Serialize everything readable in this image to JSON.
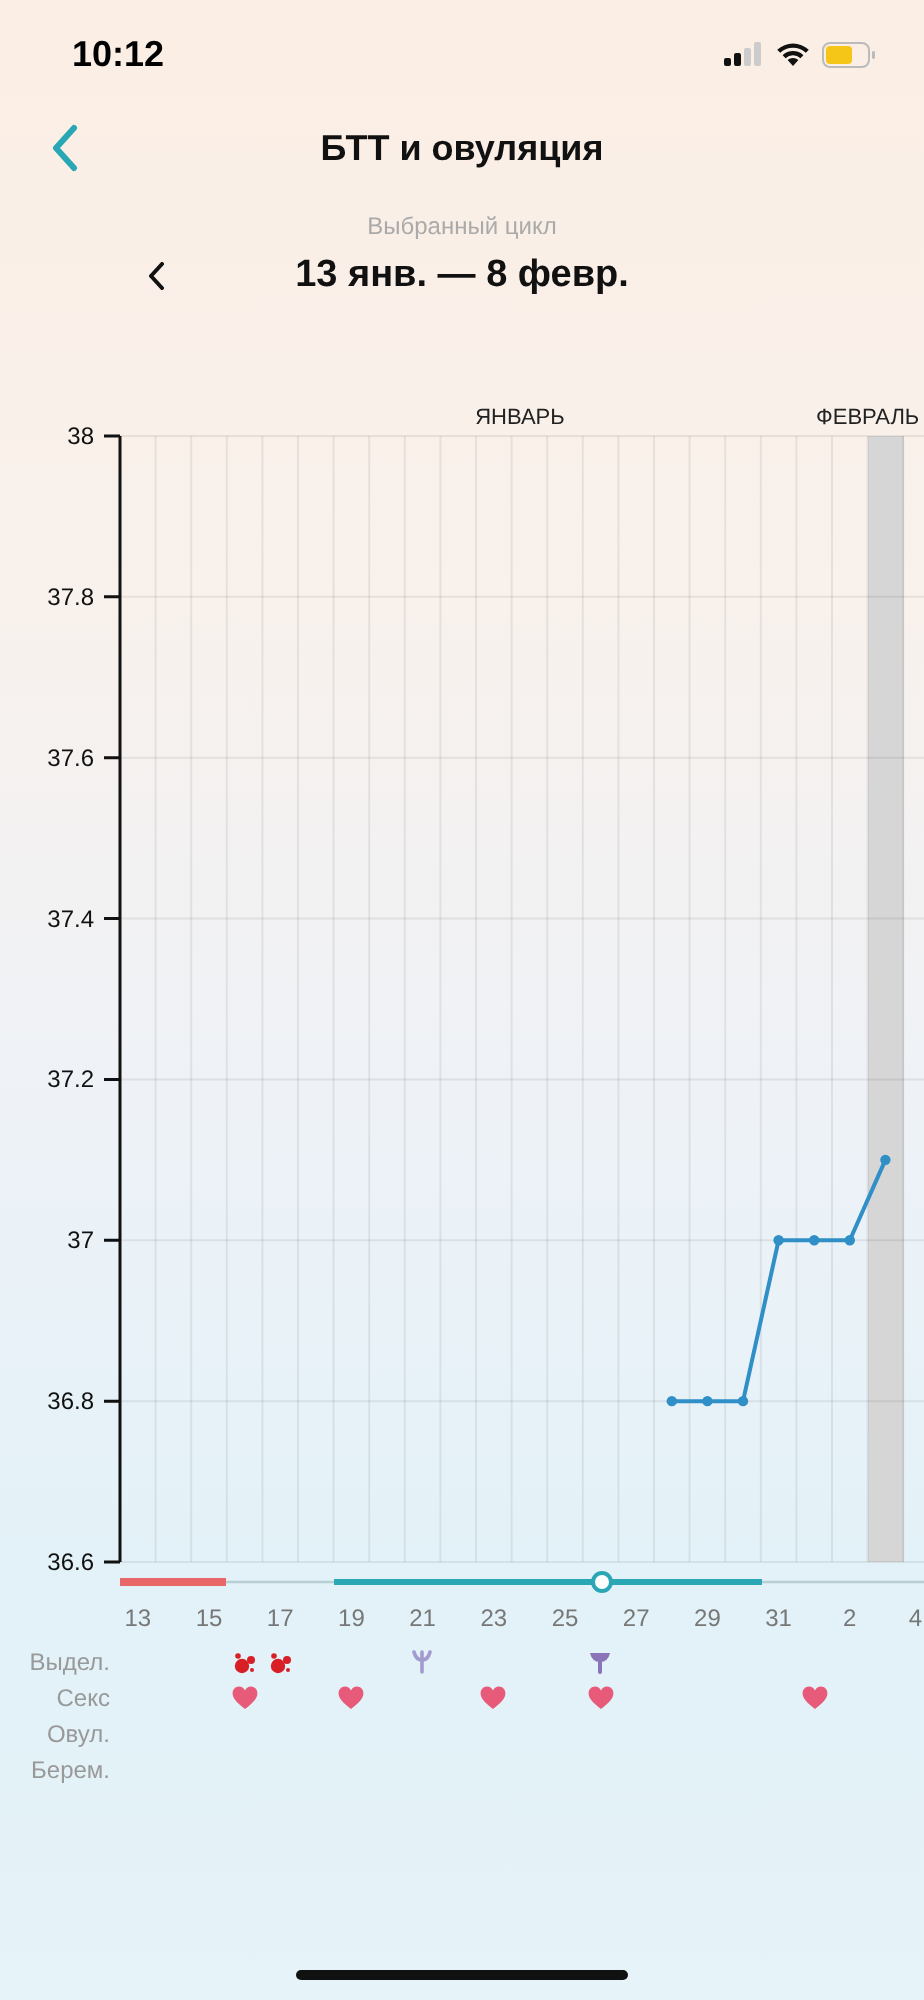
{
  "status_bar": {
    "time": "10:12"
  },
  "header": {
    "title": "БТТ и овуляция"
  },
  "cycle": {
    "caption": "Выбранный цикл",
    "range": "13 янв. — 8 февр."
  },
  "chart": {
    "months": [
      "ЯНВАРЬ",
      "ФЕВРАЛЬ"
    ],
    "chart_data": {
      "type": "line",
      "categories": [
        "13",
        null,
        "15",
        null,
        "17",
        null,
        "19",
        null,
        "21",
        null,
        "23",
        null,
        "25",
        null,
        "27",
        null,
        "29",
        null,
        "31",
        null,
        "2",
        null,
        "4"
      ],
      "series": [
        {
          "color": "#2f8fc6",
          "marker": "circle",
          "values": [
            null,
            null,
            null,
            null,
            null,
            null,
            null,
            null,
            null,
            null,
            null,
            null,
            null,
            null,
            null,
            36.8,
            36.8,
            36.8,
            37,
            37,
            37,
            37.1,
            null
          ]
        }
      ],
      "ylim": [
        36.6,
        38
      ],
      "yticks": [
        36.6,
        36.8,
        37,
        37.2,
        37.4,
        37.6,
        37.8,
        38
      ],
      "grid": true
    }
  },
  "events": [
    {
      "label": "Выдел.",
      "cells": [
        null,
        null,
        null,
        {
          "kind": "blood"
        },
        {
          "kind": "blood"
        },
        null,
        null,
        null,
        {
          "kind": "discharge_light"
        },
        null,
        null,
        null,
        null,
        {
          "kind": "discharge"
        },
        null,
        null,
        null,
        null,
        null,
        null,
        null,
        null
      ]
    },
    {
      "label": "Секс",
      "cells": [
        null,
        null,
        null,
        {
          "kind": "heart"
        },
        null,
        null,
        {
          "kind": "heart"
        },
        null,
        null,
        null,
        {
          "kind": "heart"
        },
        null,
        null,
        {
          "kind": "heart"
        },
        null,
        null,
        null,
        null,
        null,
        {
          "kind": "heart"
        },
        null,
        null
      ]
    },
    {
      "label": "Овул."
    },
    {
      "label": "Берем."
    }
  ]
}
